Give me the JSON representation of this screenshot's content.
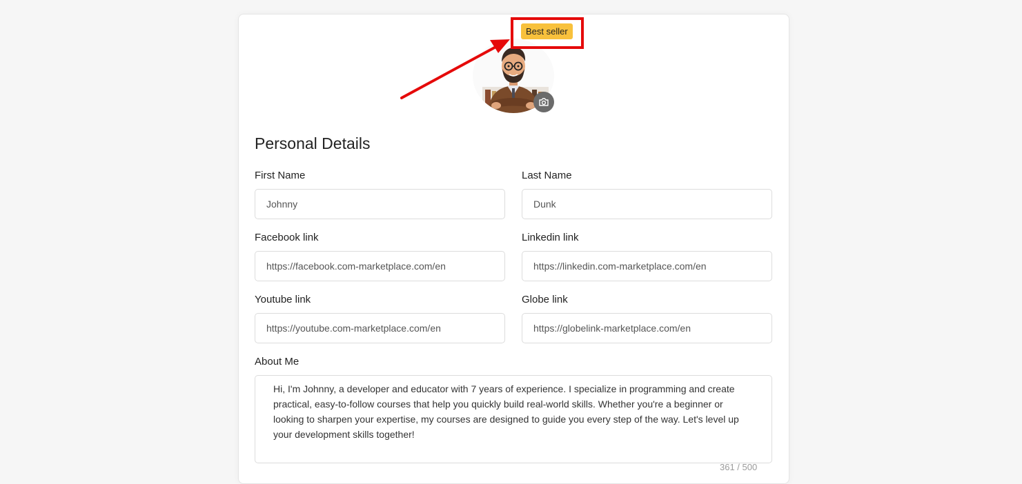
{
  "profile": {
    "badge_label": "Best seller",
    "avatar_alt": "Profile avatar"
  },
  "section": {
    "title": "Personal Details"
  },
  "fields": {
    "first_name": {
      "label": "First Name",
      "value": "Johnny"
    },
    "last_name": {
      "label": "Last Name",
      "value": "Dunk"
    },
    "facebook": {
      "label": "Facebook link",
      "value": "https://facebook.com-marketplace.com/en"
    },
    "linkedin": {
      "label": "Linkedin link",
      "value": "https://linkedin.com-marketplace.com/en"
    },
    "youtube": {
      "label": "Youtube link",
      "value": "https://youtube.com-marketplace.com/en"
    },
    "globe": {
      "label": "Globe link",
      "value": "https://globelink-marketplace.com/en"
    },
    "about": {
      "label": "About Me",
      "value": "Hi, I'm Johnny, a developer and educator with 7 years of experience. I specialize in programming and create practical, easy-to-follow courses that help you quickly build real-world skills. Whether you're a beginner or looking to sharpen your expertise, my courses are designed to guide you every step of the way. Let's level up your development skills together!",
      "counter": "361 / 500"
    }
  },
  "colors": {
    "badge": "#f8c13c",
    "highlight": "#e50a0a",
    "camera": "#6b6b6b"
  }
}
